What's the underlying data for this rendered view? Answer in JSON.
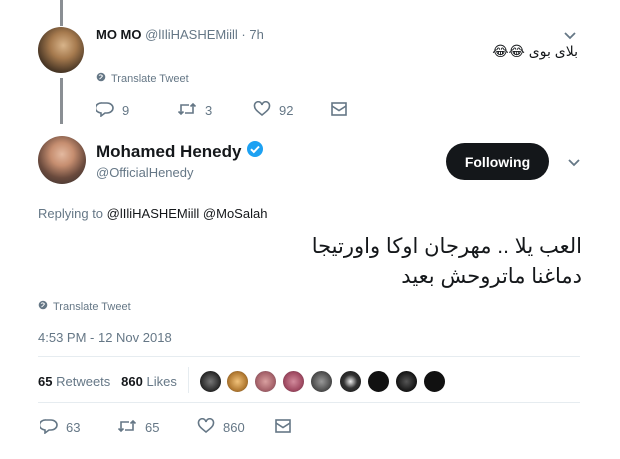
{
  "reply_tweet": {
    "display_name": "MO MO",
    "handle": "@lIliHASHEMiill",
    "time_sep": "·",
    "time": "7h",
    "text": "بلاى بوى 😂😂",
    "translate": "Translate Tweet",
    "actions": {
      "replies": "9",
      "retweets": "3",
      "likes": "92"
    }
  },
  "main_tweet": {
    "display_name": "Mohamed Henedy",
    "handle": "@OfficialHenedy",
    "follow_label": "Following",
    "replying_prefix": "Replying to",
    "replying_to": "@lIliHASHEMiill @MoSalah",
    "text_line1": "العب يلا .. مهرجان اوكا واورتيجا",
    "text_line2": "دماغنا ماتروحش بعيد",
    "translate": "Translate Tweet",
    "timestamp": "4:53 PM - 12 Nov 2018",
    "stats": {
      "retweets_count": "65",
      "retweets_label": "Retweets",
      "likes_count": "860",
      "likes_label": "Likes"
    },
    "actions": {
      "replies": "63",
      "retweets": "65",
      "likes": "860"
    }
  },
  "colors": {
    "verified": "#1da1f2",
    "muted": "#657786",
    "button": "#14171a"
  },
  "icons": [
    "chevron-down-icon",
    "globe-icon",
    "reply-icon",
    "retweet-icon",
    "heart-icon",
    "dm-icon",
    "verified-badge-icon"
  ]
}
